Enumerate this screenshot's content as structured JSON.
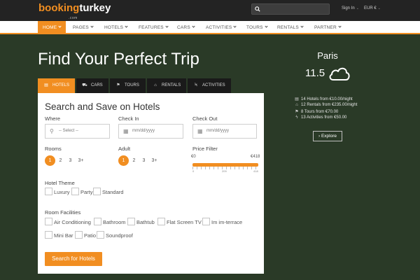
{
  "header": {
    "logo_part1": "booking",
    "logo_part2": "turkey",
    "logo_sub": ".com",
    "search_placeholder": "",
    "signin_label": "Sign In",
    "currency_label": "EUR €"
  },
  "nav": {
    "items": [
      {
        "label": "Home",
        "active": true
      },
      {
        "label": "Pages"
      },
      {
        "label": "Hotels"
      },
      {
        "label": "Features"
      },
      {
        "label": "Cars"
      },
      {
        "label": "Activities"
      },
      {
        "label": "Tours"
      },
      {
        "label": "Rentals"
      },
      {
        "label": "Partner"
      }
    ]
  },
  "hero": {
    "title": "Find Your Perfect Trip"
  },
  "tabs": [
    {
      "label": "Hotels",
      "icon": "hotel-icon",
      "active": true
    },
    {
      "label": "Cars",
      "icon": "car-icon"
    },
    {
      "label": "Tours",
      "icon": "flag-icon"
    },
    {
      "label": "Rentals",
      "icon": "home-icon"
    },
    {
      "label": "Activities",
      "icon": "bolt-icon"
    }
  ],
  "form": {
    "title": "Search and Save on Hotels",
    "where_label": "Where",
    "where_value": "-- Select --",
    "checkin_label": "Check In",
    "checkin_placeholder": "mm/dd/yyyy",
    "checkout_label": "Check Out",
    "checkout_placeholder": "mm/dd/yyyy",
    "rooms_label": "Rooms",
    "rooms_options": [
      "1",
      "2",
      "3",
      "3+"
    ],
    "rooms_selected": "1",
    "adult_label": "Adult",
    "adult_options": [
      "1",
      "2",
      "3",
      "3+"
    ],
    "adult_selected": "1",
    "price_label": "Price Filter",
    "price_min": "€0",
    "price_max": "€418",
    "price_scale": [
      "0",
      "209",
      "418"
    ],
    "theme_label": "Hotel Theme",
    "themes": [
      "Luxury",
      "Party",
      "Standard"
    ],
    "facilities_label": "Room Facilities",
    "facilities": [
      "Air Conditioning",
      "Bathroom",
      "Bathtub",
      "Flat Screen TV",
      "Im im-terrace",
      "Mini Bar",
      "Patio",
      "Soundproof"
    ],
    "submit_label": "Search for Hotels"
  },
  "destination": {
    "city": "Paris",
    "temperature": "11.5",
    "weather_icon": "cloud-icon",
    "stats": [
      {
        "icon": "hotel-icon",
        "text": "14 Hotels from €10.00/night"
      },
      {
        "icon": "home-icon",
        "text": "12 Rentals from €235.00/night"
      },
      {
        "icon": "flag-icon",
        "text": "8 Tours from €70.00"
      },
      {
        "icon": "bolt-icon",
        "text": "13 Activities from €50.00"
      }
    ],
    "explore_label": "Explore"
  },
  "colors": {
    "accent": "#f18e21",
    "background": "#2a3a27",
    "topbar": "#232323"
  }
}
